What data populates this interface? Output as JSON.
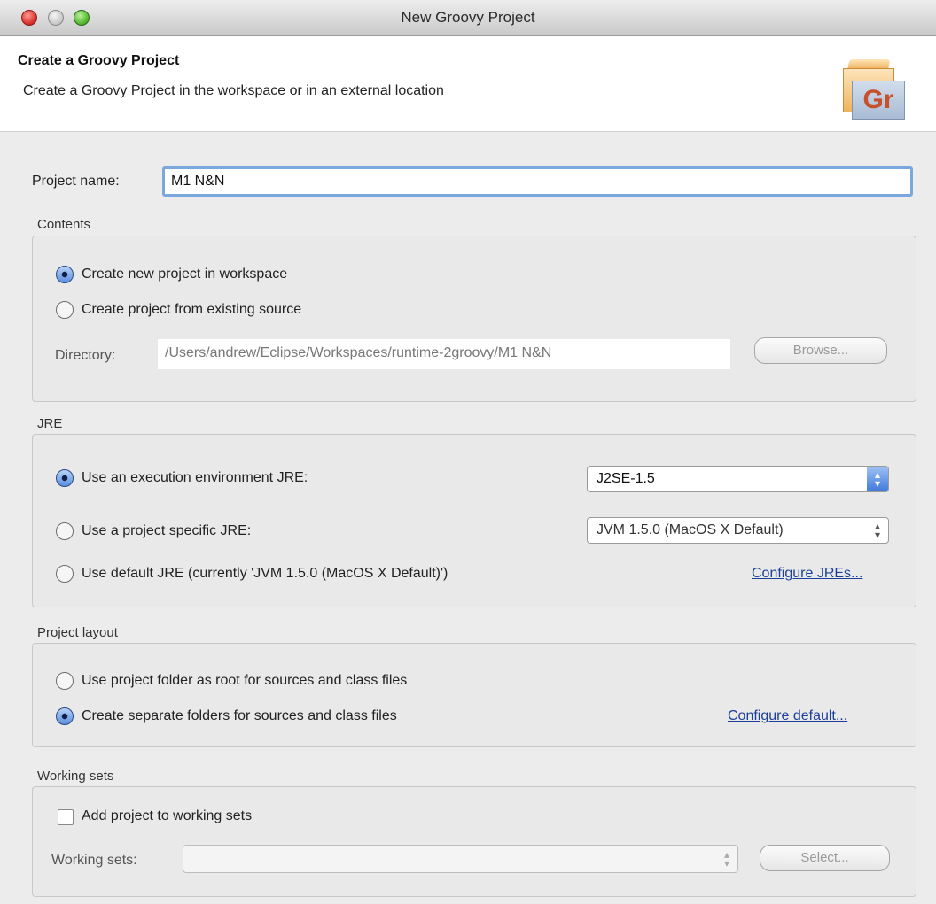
{
  "window": {
    "title": "New Groovy Project"
  },
  "banner": {
    "title": "Create a Groovy Project",
    "description": "Create a Groovy Project in the workspace or in an external location",
    "icon_label": "Gr"
  },
  "project_name": {
    "label": "Project name:",
    "value": "M1 N&N"
  },
  "contents": {
    "group_label": "Contents",
    "option_workspace": "Create new project in workspace",
    "option_existing": "Create project from existing source",
    "selected": "workspace",
    "directory_label": "Directory:",
    "directory_value": "/Users/andrew/Eclipse/Workspaces/runtime-2groovy/M1 N&N",
    "browse_label": "Browse..."
  },
  "jre": {
    "group_label": "JRE",
    "option_execution_env": "Use an execution environment JRE:",
    "execution_env_value": "J2SE-1.5",
    "option_project_specific": "Use a project specific JRE:",
    "project_specific_value": "JVM 1.5.0 (MacOS X Default)",
    "option_default": "Use default JRE (currently 'JVM 1.5.0 (MacOS X Default)')",
    "configure_link": "Configure JREs...",
    "selected": "execution_env"
  },
  "project_layout": {
    "group_label": "Project layout",
    "option_root": "Use project folder as root for sources and class files",
    "option_separate": "Create separate folders for sources and class files",
    "configure_link": "Configure default...",
    "selected": "separate"
  },
  "working_sets": {
    "group_label": "Working sets",
    "add_checkbox_label": "Add project to working sets",
    "add_checked": false,
    "working_sets_label": "Working sets:",
    "working_sets_value": "",
    "select_label": "Select..."
  },
  "colors": {
    "link": "#1c3f9a",
    "focus_ring": "#7ba7df",
    "radio_selected": "#5a8fe0"
  }
}
